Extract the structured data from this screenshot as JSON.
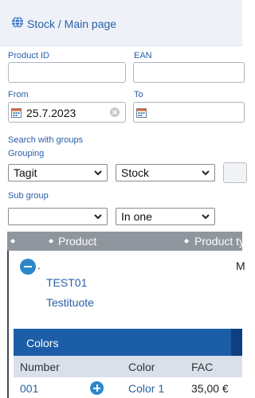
{
  "header": {
    "breadcrumb": "Stock / Main page"
  },
  "form": {
    "product_id_label": "Product ID",
    "ean_label": "EAN",
    "from_label": "From",
    "from_value": "25.7.2023",
    "to_label": "To",
    "search_with_groups": "Search with groups",
    "grouping_label": "Grouping",
    "grouping_value": "Tagit",
    "grouping2_value": "Stock",
    "subgroup_label": "Sub group",
    "subgroup_value": "",
    "in_one_value": "In one"
  },
  "table": {
    "col_product": "Product",
    "col_product_type": "Product ty",
    "row": {
      "dot": ".",
      "code": "TEST01",
      "name": "Testituote",
      "type_initial": "M"
    }
  },
  "colors": {
    "title": "Colors",
    "headers": {
      "number": "Number",
      "color": "Color",
      "fac": "FAC"
    },
    "rows": [
      {
        "number": "001",
        "color": "Color 1",
        "fac": "35,00 €"
      }
    ]
  },
  "style": {
    "accent": "#2a5fa8",
    "panel_header": "#1c5da8",
    "table_header": "#8f969e"
  }
}
